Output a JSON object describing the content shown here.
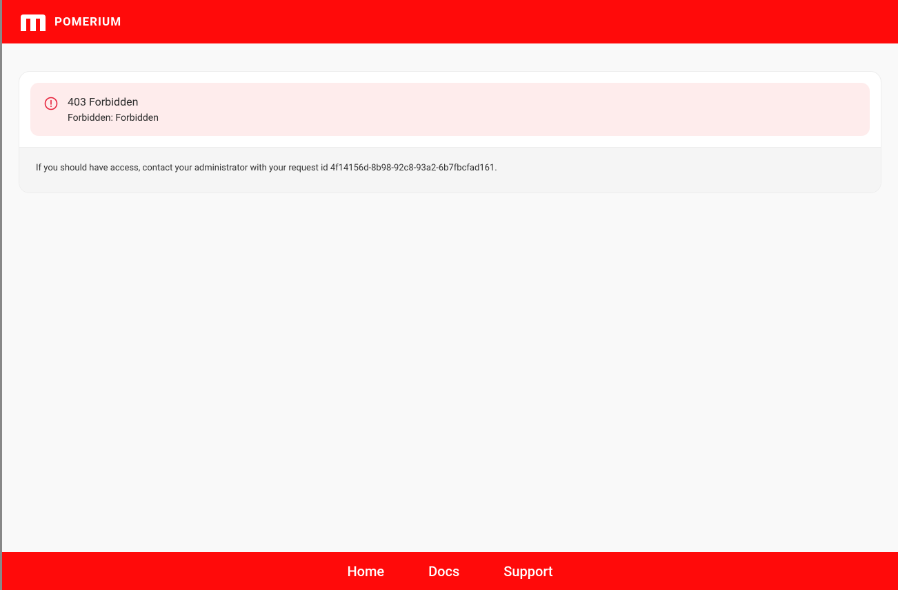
{
  "header": {
    "brand": "POMERIUM"
  },
  "error": {
    "title": "403 Forbidden",
    "message": "Forbidden: Forbidden"
  },
  "info": {
    "text": "If you should have access, contact your administrator with your request id 4f14156d-8b98-92c8-93a2-6b7fbcfad161."
  },
  "footer": {
    "links": {
      "home": "Home",
      "docs": "Docs",
      "support": "Support"
    }
  }
}
